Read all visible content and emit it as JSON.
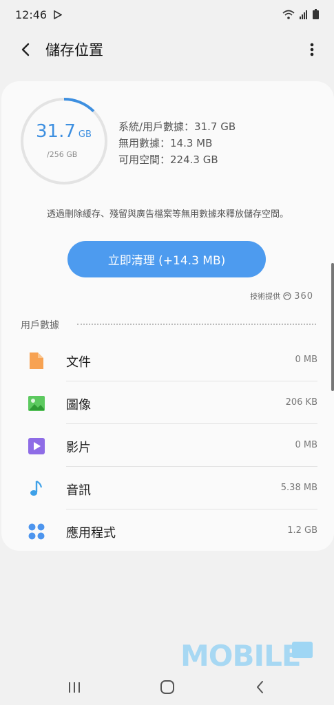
{
  "status_bar": {
    "time": "12:46"
  },
  "app_bar": {
    "title": "儲存位置"
  },
  "summary": {
    "used_value": "31.7",
    "used_unit": "GB",
    "total": "/256 GB",
    "used_fraction": 0.124,
    "stats": [
      "系統/用戶數據：31.7 GB",
      "無用數據：14.3 MB",
      "可用空間：224.3 GB"
    ]
  },
  "hint": "透過刪除緩存、殘留與廣告檔案等無用數據來釋放儲存空間。",
  "clean_button": "立即清理 (+14.3 MB)",
  "provider": {
    "label": "技術提供",
    "brand": "360"
  },
  "section": {
    "title": "用戶數據"
  },
  "items": [
    {
      "icon": "document-icon",
      "name": "文件",
      "size": "0 MB",
      "color": "#f7a252"
    },
    {
      "icon": "image-icon",
      "name": "圖像",
      "size": "206 KB",
      "color": "#5cc95f"
    },
    {
      "icon": "video-icon",
      "name": "影片",
      "size": "0 MB",
      "color": "#8e6ce6"
    },
    {
      "icon": "music-note-icon",
      "name": "音訊",
      "size": "5.38 MB",
      "color": "#3da0e8"
    },
    {
      "icon": "apps-icon",
      "name": "應用程式",
      "size": "1.2 GB",
      "color": "#4d95ee"
    }
  ],
  "watermark": "MOBILE"
}
